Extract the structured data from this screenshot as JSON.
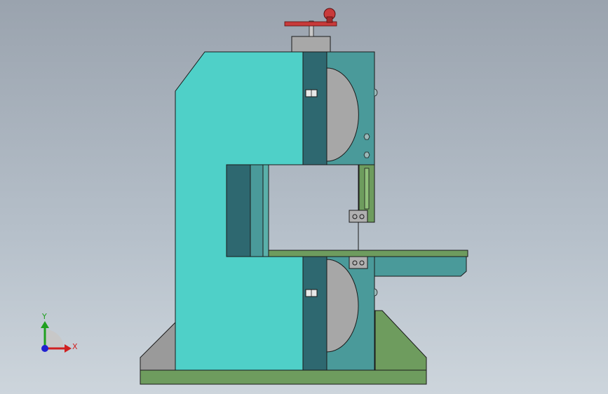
{
  "scene": {
    "background": [
      "#9aa3ae",
      "#cdd5dc"
    ],
    "colors": {
      "frame": "#4fd0c8",
      "frame_dark": "#2e6870",
      "frame_mid": "#4a9a9a",
      "wheel": "#a7a7a7",
      "base": "#6e9c5e",
      "table": "#6e9c5e",
      "foot_gray": "#9a9a9a",
      "handwheel": "#c83a3a",
      "outline": "#1a1a1a"
    }
  },
  "triad": {
    "x_label": "X",
    "y_label": "Y",
    "x_color": "#d02020",
    "y_color": "#20a020",
    "z_color": "#2020d0"
  }
}
